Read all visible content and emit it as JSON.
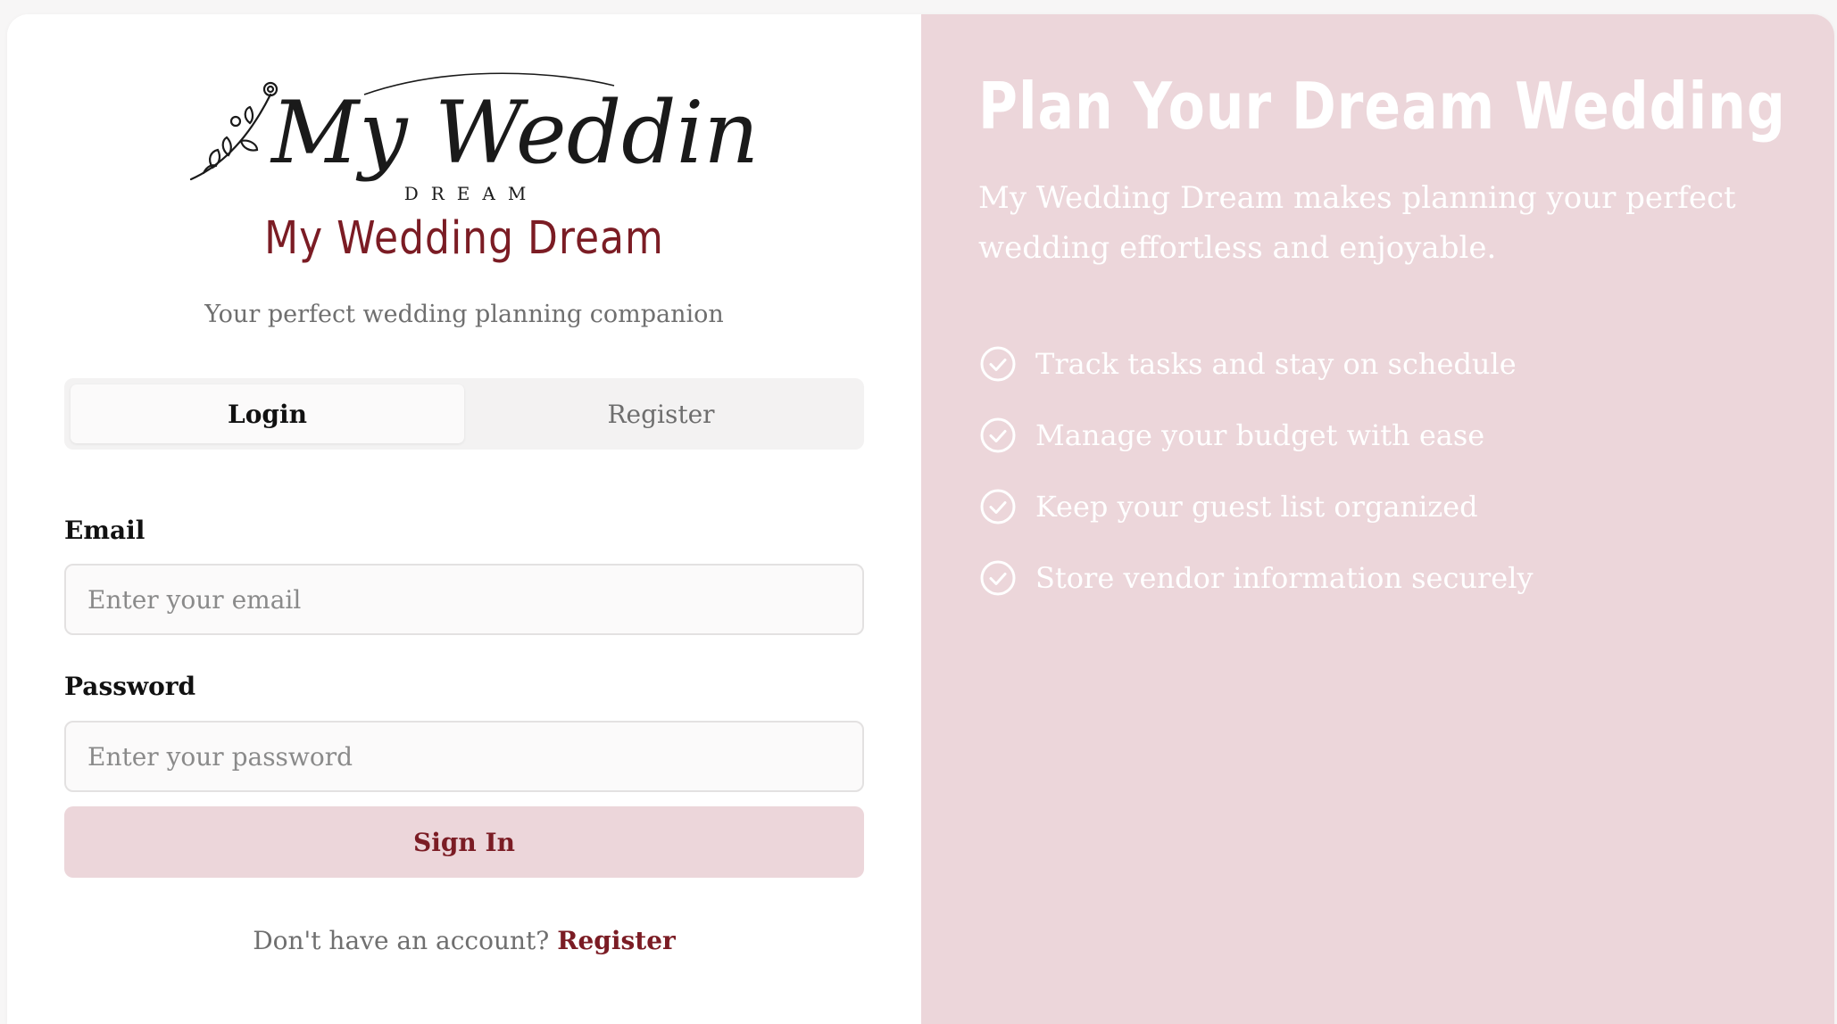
{
  "brand": {
    "logo_script": "My Wedding",
    "logo_sub": "DREAM",
    "title": "My Wedding Dream",
    "tagline": "Your perfect wedding planning companion"
  },
  "auth": {
    "tabs": [
      {
        "label": "Login",
        "active": true
      },
      {
        "label": "Register",
        "active": false
      }
    ],
    "email": {
      "label": "Email",
      "placeholder": "Enter your email",
      "value": ""
    },
    "password": {
      "label": "Password",
      "placeholder": "Enter your password",
      "value": ""
    },
    "submit_label": "Sign In",
    "switch_prompt": "Don't have an account?",
    "switch_link": "Register"
  },
  "hero": {
    "title": "Plan Your Dream Wedding",
    "description": "My Wedding Dream makes planning your perfect wedding effortless and enjoyable.",
    "features": [
      {
        "icon": "check-circle-icon",
        "text": "Track tasks and stay on schedule"
      },
      {
        "icon": "check-circle-icon",
        "text": "Manage your budget with ease"
      },
      {
        "icon": "check-circle-icon",
        "text": "Keep your guest list organized"
      },
      {
        "icon": "check-circle-icon",
        "text": "Store vendor information securely"
      }
    ]
  },
  "colors": {
    "accent": "#7b1c24",
    "panel_pink": "#ecd6da",
    "muted_text": "#6f6f6f"
  }
}
